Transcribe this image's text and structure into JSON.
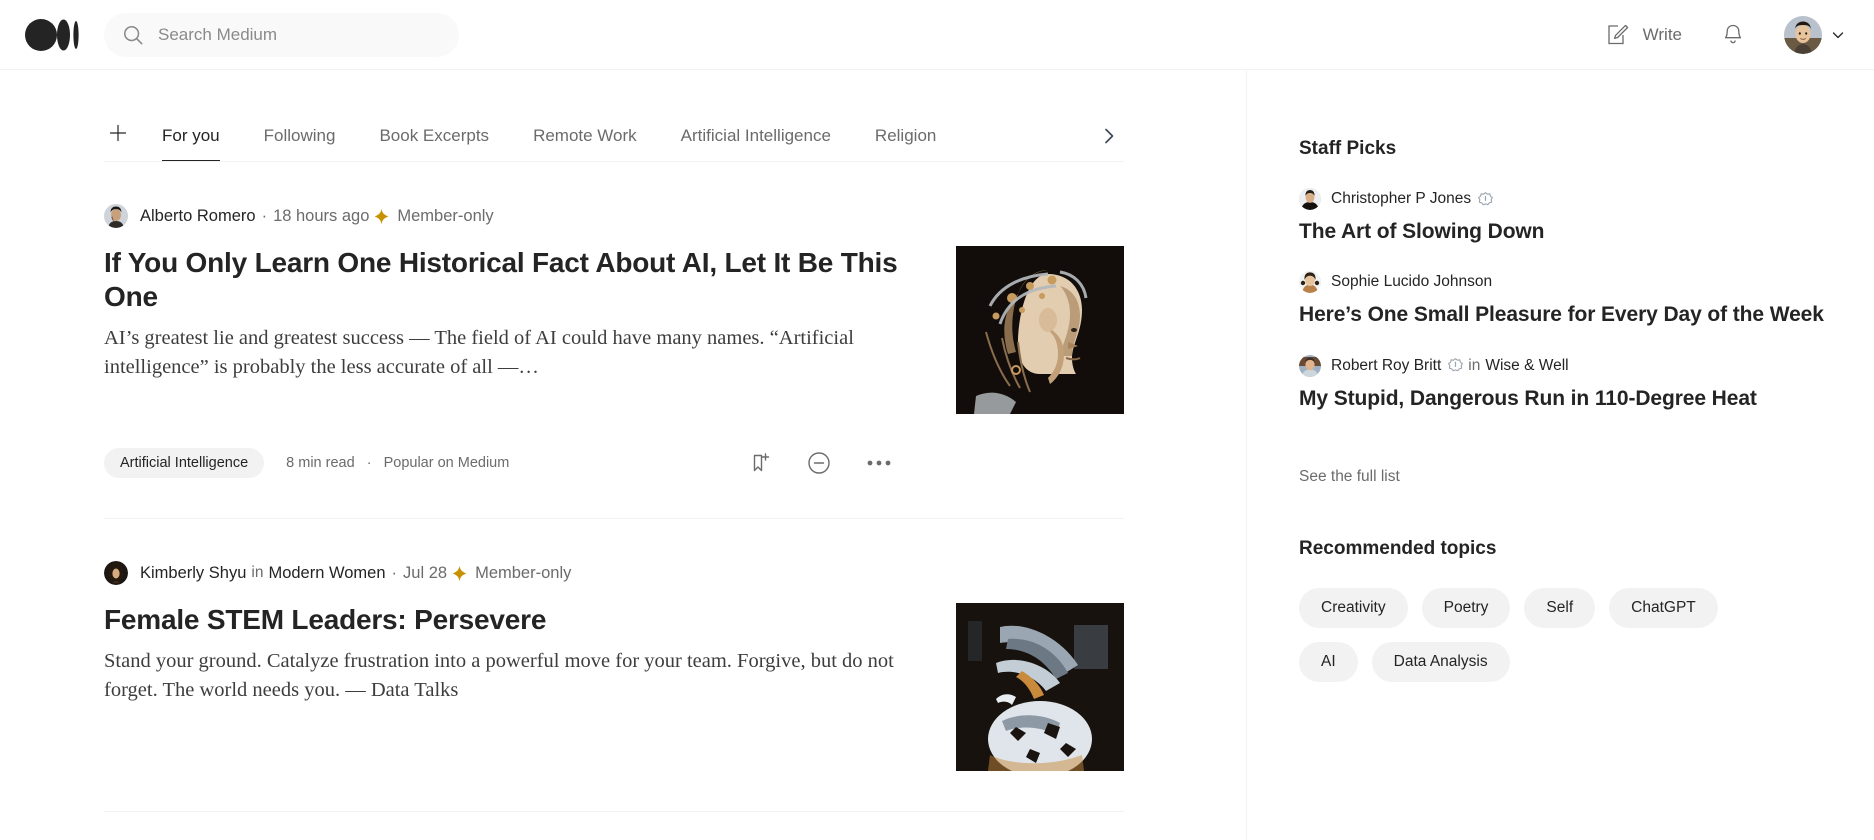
{
  "header": {
    "logo_name": "medium-logo",
    "search": {
      "placeholder": "Search Medium",
      "value": ""
    },
    "write_label": "Write",
    "icons": {
      "search": "search-icon",
      "write": "write-pencil-icon",
      "notifications": "bell-icon",
      "avatar": "user-avatar",
      "chevron": "chevron-down-icon"
    }
  },
  "tabs": {
    "add_label": "+",
    "items": [
      {
        "label": "For you",
        "active": true
      },
      {
        "label": "Following",
        "active": false
      },
      {
        "label": "Book Excerpts",
        "active": false
      },
      {
        "label": "Remote Work",
        "active": false
      },
      {
        "label": "Artificial Intelligence",
        "active": false
      },
      {
        "label": "Religion",
        "active": false
      }
    ],
    "next_icon": "chevron-right-icon"
  },
  "feed": [
    {
      "author": "Alberto Romero",
      "publication": "",
      "in_word": "",
      "separator": "·",
      "date": "18 hours ago",
      "member_label": "Member-only",
      "title": "If You Only Learn One Historical Fact About AI, Let It Be This One",
      "excerpt": "AI’s greatest lie and greatest success — The field of AI could have many names. “Artificial intelligence” is probably the less accurate of all —…",
      "tag": "Artificial Intelligence",
      "read_time": "8 min read",
      "source": "Popular on Medium",
      "meta_dot": "·"
    },
    {
      "author": "Kimberly Shyu",
      "publication": "Modern Women",
      "in_word": "in",
      "separator": "·",
      "date": "Jul 28",
      "member_label": "Member-only",
      "title": "Female STEM Leaders: Persevere",
      "excerpt": "Stand your ground. Catalyze frustration into a powerful move for your team. Forgive, but do not forget. The world needs you. — Data Talks",
      "tag": "",
      "read_time": "",
      "source": "",
      "meta_dot": ""
    }
  ],
  "sidebar": {
    "staff_picks_title": "Staff Picks",
    "picks": [
      {
        "author": "Christopher P Jones",
        "verified": true,
        "in_word": "",
        "publication": "",
        "title": "The Art of Slowing Down"
      },
      {
        "author": "Sophie Lucido Johnson",
        "verified": false,
        "in_word": "",
        "publication": "",
        "title": "Here’s One Small Pleasure for Every Day of the Week"
      },
      {
        "author": "Robert Roy Britt",
        "verified": true,
        "in_word": "in",
        "publication": "Wise & Well",
        "title": "My Stupid, Dangerous Run in 110-Degree Heat"
      }
    ],
    "see_full_list": "See the full list",
    "topics_title": "Recommended topics",
    "topics": [
      "Creativity",
      "Poetry",
      "Self",
      "ChatGPT",
      "AI",
      "Data Analysis"
    ]
  },
  "colors": {
    "text": "#242424",
    "muted": "#6b6b6b",
    "star_gold": "#c79100",
    "pill_bg": "#f2f2f2",
    "border": "#f2f2f2"
  }
}
